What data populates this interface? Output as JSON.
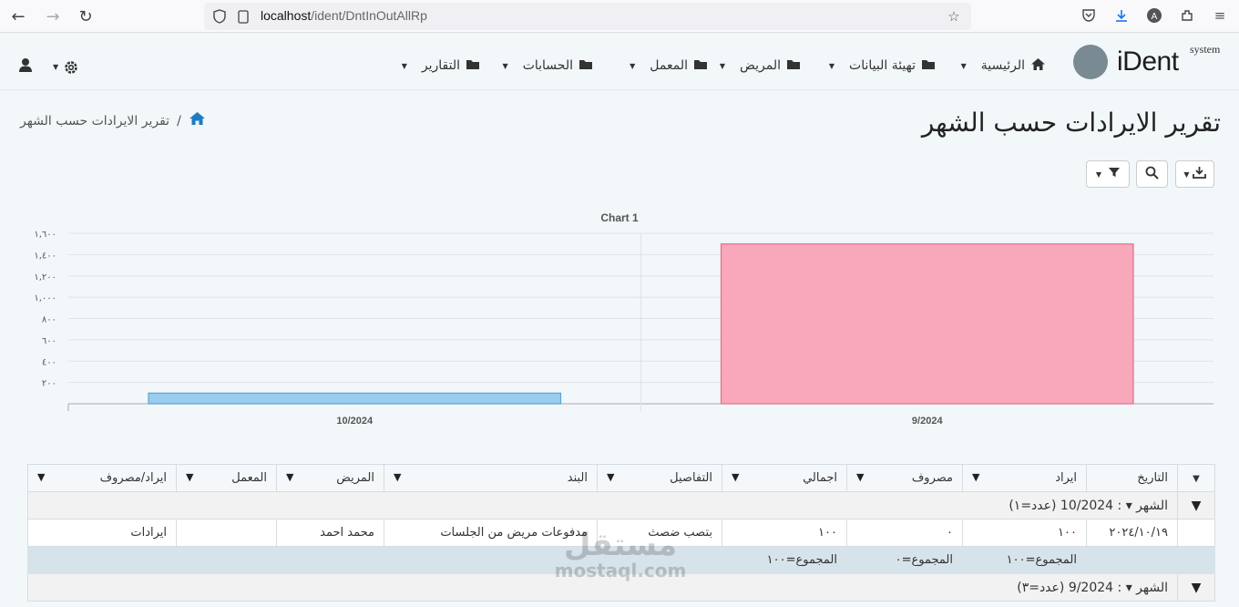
{
  "browser": {
    "url_host": "localhost",
    "url_path": "/ident/DntInOutAllRp"
  },
  "app": {
    "logo_text": "iDent",
    "logo_sub": "system"
  },
  "menu": [
    {
      "label": "الرئيسية",
      "icon": "home-icon"
    },
    {
      "label": "تهيئة البيانات",
      "icon": "folder-icon"
    },
    {
      "label": "المريض",
      "icon": "folder-icon"
    },
    {
      "label": "المعمل",
      "icon": "folder-icon"
    },
    {
      "label": "الحسابات",
      "icon": "folder-icon"
    },
    {
      "label": "التقارير",
      "icon": "folder-icon"
    }
  ],
  "breadcrumb": {
    "current": "تقرير الايرادات حسب الشهر",
    "separator": "/"
  },
  "page": {
    "title": "تقرير الايرادات حسب الشهر"
  },
  "chart_data": {
    "type": "bar",
    "title": "Chart 1",
    "categories": [
      "10/2024",
      "9/2024"
    ],
    "values": [
      100,
      1500
    ],
    "ylim": [
      0,
      1600
    ],
    "yticks": [
      200,
      400,
      600,
      800,
      1000,
      1200,
      1400,
      1600
    ],
    "ytick_labels": [
      "٢٠٠",
      "٤٠٠",
      "٦٠٠",
      "٨٠٠",
      "١,٠٠٠",
      "١,٢٠٠",
      "١,٤٠٠",
      "١,٦٠٠"
    ],
    "colors": [
      "#99ccee",
      "#f9a8bc"
    ],
    "grid": true
  },
  "table": {
    "columns": [
      "التاريخ",
      "ايراد",
      "مصروف",
      "اجمالي",
      "التفاصيل",
      "البند",
      "المريض",
      "المعمل",
      "ايراد/مصروف"
    ],
    "group1": {
      "label": "الشهر ▾ : 10/2024 (عدد=١)"
    },
    "row1": {
      "date": "٢٠٢٤/١٠/١٩",
      "income": "١٠٠",
      "expense": "٠",
      "total": "١٠٠",
      "details": "بتصب ضصث",
      "item": "مدفوعات مريض من الجلسات",
      "patient": "محمد احمد",
      "lab": "",
      "type": "ايرادات"
    },
    "summary1": {
      "income_sum": "المجموع=١٠٠",
      "expense_sum": "المجموع=٠",
      "total_sum": "المجموع=١٠٠"
    },
    "group2": {
      "label": "الشهر ▾ : 9/2024 (عدد=٣)"
    }
  },
  "watermark": {
    "line1": "مستقل",
    "line2": "mostaql.com"
  }
}
